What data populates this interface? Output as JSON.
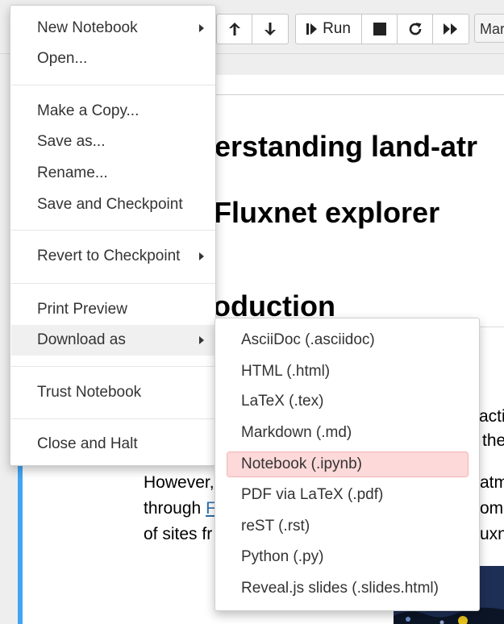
{
  "toolbar": {
    "run_label": "Run",
    "cell_type_value": "Markdown",
    "icons": [
      "arrow-up-icon",
      "arrow-down-icon",
      "step-run-icon",
      "stop-icon",
      "restart-icon",
      "fast-forward-icon"
    ]
  },
  "notebook": {
    "heading_line1": "erstanding land-atr",
    "heading_line2": "Fluxnet explorer",
    "heading_intro": "oduction",
    "text_right_1": "acti",
    "text_right_2": "the",
    "para_1_start": "However,",
    "para_1_end": "atm",
    "para_2_start": "through",
    "para_2_link": "F",
    "para_2_end": "om",
    "para_3_start": "of sites fr",
    "para_3_end": "uxn"
  },
  "file_menu": {
    "items": [
      {
        "label": "New Notebook",
        "submenu": true
      },
      {
        "label": "Open..."
      },
      {
        "label": "Make a Copy..."
      },
      {
        "label": "Save as..."
      },
      {
        "label": "Rename..."
      },
      {
        "label": "Save and Checkpoint"
      },
      {
        "label": "Revert to Checkpoint",
        "submenu": true
      },
      {
        "label": "Print Preview"
      },
      {
        "label": "Download as",
        "submenu": true,
        "active": true
      },
      {
        "label": "Trust Notebook"
      },
      {
        "label": "Close and Halt"
      }
    ]
  },
  "download_submenu": {
    "items": [
      {
        "label": "AsciiDoc (.asciidoc)"
      },
      {
        "label": "HTML (.html)"
      },
      {
        "label": "LaTeX (.tex)"
      },
      {
        "label": "Markdown (.md)"
      },
      {
        "label": "Notebook (.ipynb)",
        "highlighted": true
      },
      {
        "label": "PDF via LaTeX (.pdf)"
      },
      {
        "label": "reST (.rst)"
      },
      {
        "label": "Python (.py)"
      },
      {
        "label": "Reveal.js slides (.slides.html)"
      }
    ]
  },
  "colors": {
    "highlight_bg": "#fdd9d9",
    "selected_cell_bar": "#42a5f5",
    "link": "#296eaa"
  }
}
